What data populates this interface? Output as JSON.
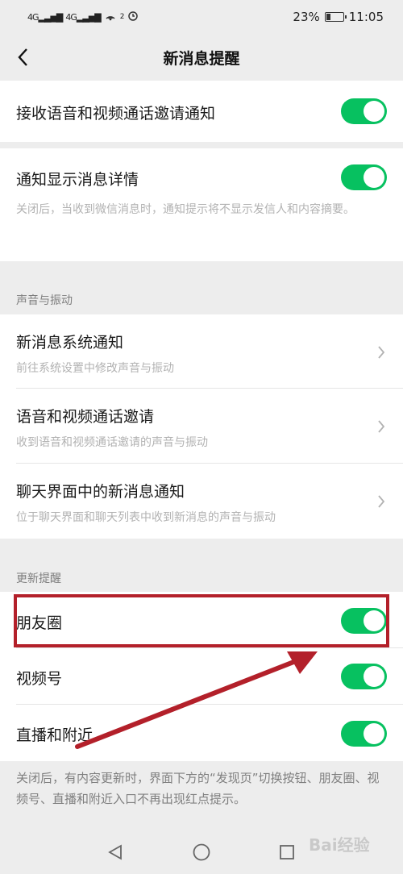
{
  "status_bar": {
    "signal1": "4G",
    "signal2": "4G",
    "notif_count": "2",
    "battery_pct": "23%",
    "time": "11:05"
  },
  "header": {
    "title": "新消息提醒",
    "back_icon": "chevron-left-icon"
  },
  "top_section": {
    "items": [
      {
        "title": "接收语音和视频通话邀请通知",
        "switch_on": true
      }
    ]
  },
  "detail_section": {
    "title": "通知显示消息详情",
    "switch_on": true,
    "desc": "关闭后，当收到微信消息时，通知提示将不显示发信人和内容摘要。"
  },
  "sound_group": {
    "label": "声音与振动",
    "items": [
      {
        "title": "新消息系统通知",
        "desc": "前往系统设置中修改声音与振动"
      },
      {
        "title": "语音和视频通话邀请",
        "desc": "收到语音和视频通话邀请的声音与振动"
      },
      {
        "title": "聊天界面中的新消息通知",
        "desc": "位于聊天界面和聊天列表中收到新消息的声音与振动"
      }
    ]
  },
  "update_group": {
    "label": "更新提醒",
    "items": [
      {
        "title": "朋友圈",
        "switch_on": true
      },
      {
        "title": "视频号",
        "switch_on": true
      },
      {
        "title": "直播和附近",
        "switch_on": true
      }
    ],
    "note": "关闭后，有内容更新时，界面下方的“发现页”切换按钮、朋友圈、视频号、直播和附近入口不再出现红点提示。"
  },
  "watermark": "Bai经验",
  "colors": {
    "switch_on": "#07c160",
    "annotation": "#b3202a"
  }
}
